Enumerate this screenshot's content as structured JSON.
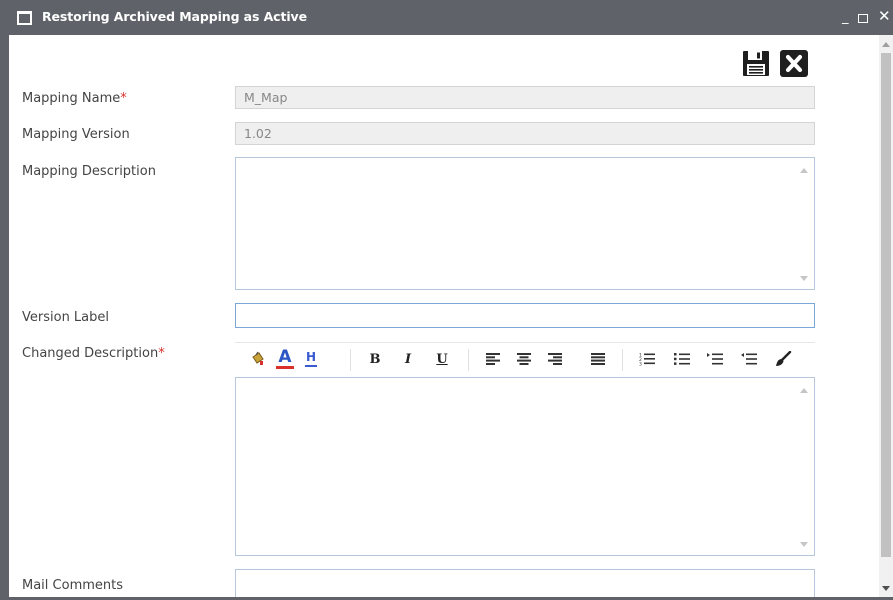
{
  "window": {
    "title": "Restoring Archived Mapping as Active",
    "minimize_glyph": "_",
    "close_glyph": "✕"
  },
  "toolbar": {
    "save_icon": "save-icon",
    "close_icon": "close-icon"
  },
  "form": {
    "mapping_name": {
      "label": "Mapping Name",
      "required_mark": "*",
      "value": "M_Map"
    },
    "mapping_version": {
      "label": "Mapping Version",
      "value": "1.02"
    },
    "mapping_description": {
      "label": "Mapping Description",
      "value": ""
    },
    "version_label": {
      "label": "Version Label",
      "value": ""
    },
    "changed_description": {
      "label": "Changed Description",
      "required_mark": "*",
      "value": ""
    },
    "mail_comments": {
      "label": "Mail Comments",
      "value": ""
    }
  },
  "editor_toolbar": {
    "buttons": [
      "paint-bucket-icon",
      "font-color-icon",
      "highlight-icon",
      "bold-icon",
      "italic-icon",
      "underline-icon",
      "align-left-icon",
      "align-center-icon",
      "align-right-icon",
      "align-justify-icon",
      "numbered-list-icon",
      "bullet-list-icon",
      "indent-icon",
      "outdent-icon",
      "clear-format-icon"
    ],
    "bold_glyph": "B",
    "italic_glyph": "I",
    "underline_glyph": "U",
    "font_color_glyph": "A",
    "highlight_glyph": "H"
  },
  "colors": {
    "titlebar": "#5f6369",
    "required": "#d9302c",
    "font_color_underline": "#d9302c",
    "highlight": "#3a5bd0"
  }
}
